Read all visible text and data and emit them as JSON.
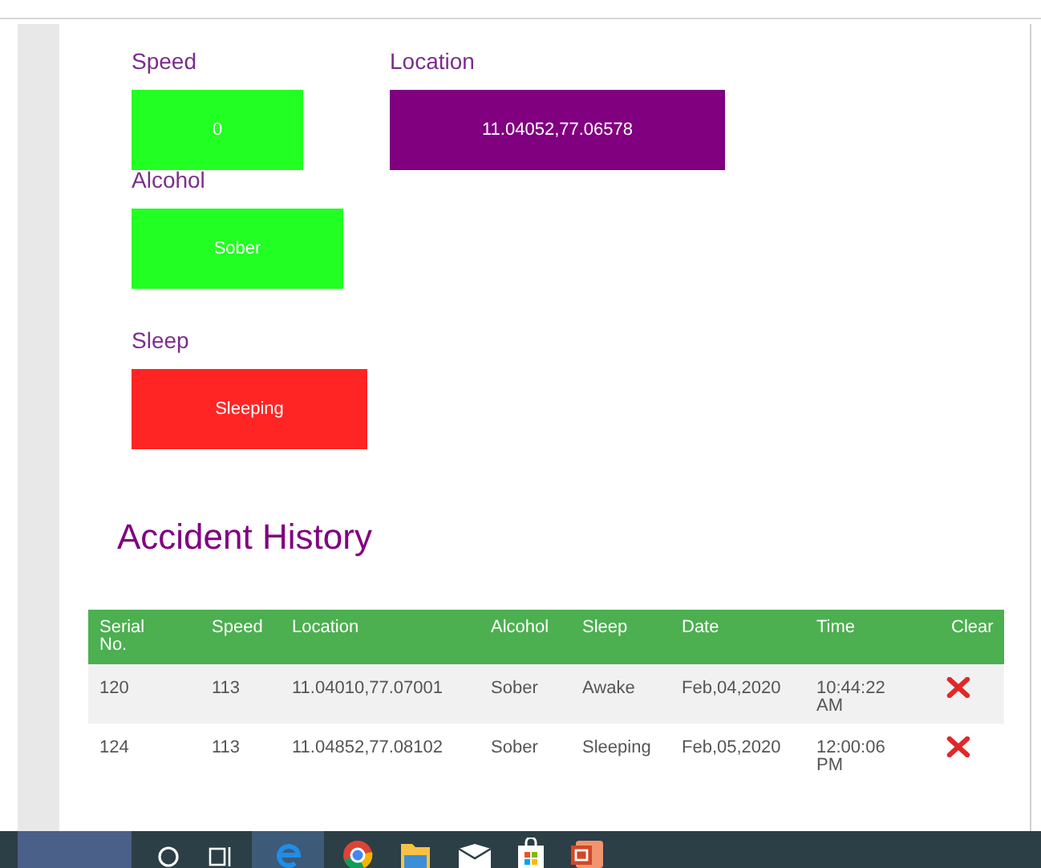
{
  "status_rows": [
    [
      {
        "label": "Speed",
        "value": "0",
        "color": "#22ff22"
      },
      {
        "label": "Location",
        "value": "11.04052,77.06578",
        "color": "#800080"
      }
    ],
    [
      {
        "label": "Alcohol",
        "value": "Sober",
        "color": "#22ff22"
      }
    ],
    [
      {
        "label": "Sleep",
        "value": "Sleeping",
        "color": "#ff2525"
      }
    ]
  ],
  "accident_history": {
    "title": "Accident History",
    "columns": [
      "Serial No.",
      "Speed",
      "Location",
      "Alcohol",
      "Sleep",
      "Date",
      "Time",
      "Clear"
    ],
    "rows": [
      {
        "cells": [
          "120",
          "113",
          "11.04010,77.07001",
          "Sober",
          "Awake",
          "Feb,04,2020",
          "10:44:22 AM"
        ]
      },
      {
        "cells": [
          "124",
          "113",
          "11.04852,77.08102",
          "Sober",
          "Sleeping",
          "Feb,05,2020",
          "12:00:06 PM"
        ]
      }
    ]
  }
}
